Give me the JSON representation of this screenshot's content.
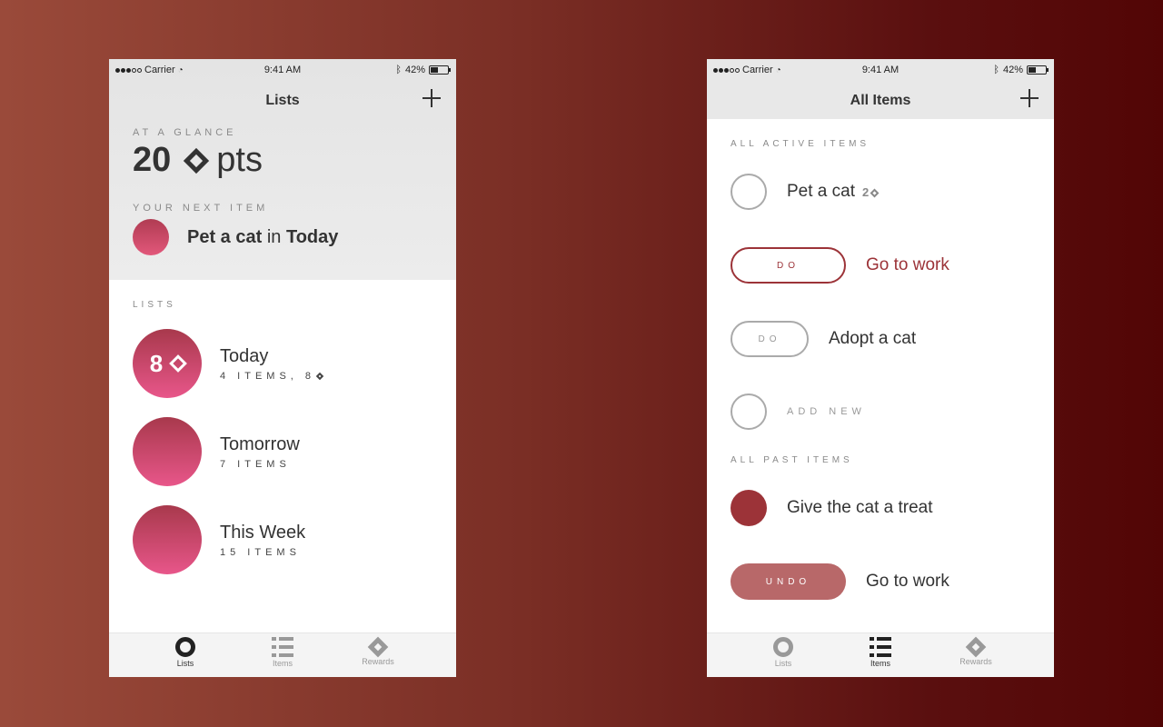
{
  "status": {
    "carrier": "Carrier",
    "time": "9:41 AM",
    "battery": "42%"
  },
  "left": {
    "nav_title": "Lists",
    "glance_label": "AT A GLANCE",
    "points_value": "20",
    "points_unit": "pts",
    "next_label": "YOUR NEXT ITEM",
    "next_item_name": "Pet a cat",
    "next_item_in": "in",
    "next_item_list": "Today",
    "lists_label": "LISTS",
    "lists": [
      {
        "name": "Today",
        "sub": "4 ITEMS, 8",
        "badge": "8"
      },
      {
        "name": "Tomorrow",
        "sub": "7 ITEMS"
      },
      {
        "name": "This Week",
        "sub": "15 ITEMS"
      }
    ]
  },
  "right": {
    "nav_title": "All Items",
    "active_label": "ALL ACTIVE ITEMS",
    "active_items": [
      {
        "text": "Pet a cat",
        "points": "2"
      },
      {
        "button": "DO",
        "text": "Go to work"
      },
      {
        "button": "DO",
        "text": "Adopt a cat"
      }
    ],
    "add_new": "ADD NEW",
    "past_label": "ALL PAST ITEMS",
    "past_items": [
      {
        "text": "Give the cat a treat"
      },
      {
        "button": "UNDO",
        "text": "Go to work"
      }
    ]
  },
  "tabs": [
    "Lists",
    "Items",
    "Rewards"
  ],
  "colors": {
    "accent": "#9c3338",
    "pink_top": "#a8394c",
    "pink_bottom": "#e8568a",
    "undo": "#b86869"
  }
}
